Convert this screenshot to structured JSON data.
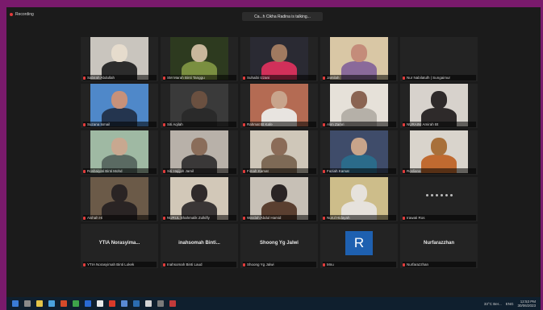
{
  "app": {
    "recording_label": "Recording",
    "talking_indicator": "Ca...h Cikha Radina is talking..."
  },
  "tiles": [
    {
      "name": "Sabirah Abdullah",
      "video": true,
      "bg": "#c9c5be",
      "head": "#e6dccd",
      "body": "#2c2c2c"
    },
    {
      "name": "SM Marah Binti Tanggu",
      "video": true,
      "bg": "#2d3a1f",
      "head": "#c9b79c",
      "body": "#7a8f40"
    },
    {
      "name": "Suhaibi Izzani",
      "video": true,
      "bg": "#2a2a33",
      "head": "#a07a60",
      "body": "#d1305a"
    },
    {
      "name": "Jamilah",
      "video": true,
      "bg": "#d9c7a5",
      "head": "#c48c7a",
      "body": "#8a6a9a"
    },
    {
      "name": "Nur Nabilatulh | Sungaimur",
      "video": false
    },
    {
      "name": "Suzana Ismail",
      "video": true,
      "bg": "#4f88c9",
      "head": "#c6917a",
      "body": "#24354f"
    },
    {
      "name": "Siti Aqilah",
      "video": true,
      "bg": "#3a3a3a",
      "head": "#6a5040",
      "body": "#2a2a2a"
    },
    {
      "name": "Rahmat Bt Kafe",
      "video": true,
      "bg": "#b46b53",
      "head": "#c8a48c",
      "body": "#e8e4e0"
    },
    {
      "name": "Alim Zamri",
      "video": true,
      "bg": "#e6e1d9",
      "head": "#8a6452",
      "body": "#b5b0a8"
    },
    {
      "name": "NURAINI Amirah Bt",
      "video": true,
      "bg": "#d7d2cc",
      "head": "#2e2a2a",
      "body": "#2e2a2a"
    },
    {
      "name": "Rosbaiyati Binti Mohd",
      "video": true,
      "bg": "#9fb9a3",
      "head": "#c8a890",
      "body": "#5a6a62"
    },
    {
      "name": "Siti Hajijah Jamil",
      "video": true,
      "bg": "#b8b1a9",
      "head": "#8a6d5a",
      "body": "#3a3838"
    },
    {
      "name": "Fimah Kamat",
      "video": true,
      "bg": "#cfc7b9",
      "head": "#8b6c58",
      "body": "#7e6a56"
    },
    {
      "name": "Faziah Kamat",
      "video": true,
      "bg": "#3f4c6a",
      "head": "#c8a48a",
      "body": "#2b6b8a"
    },
    {
      "name": "Rosliana",
      "video": true,
      "bg": "#d9d4cc",
      "head": "#a8703a",
      "body": "#c06a30"
    },
    {
      "name": "Aishah Hi",
      "video": true,
      "bg": "#6b5a48",
      "head": "#2a2424",
      "body": "#2a2424"
    },
    {
      "name": "NURUL Shahmalik Zulkifly",
      "video": true,
      "bg": "#d2c8b8",
      "head": "#2f2a2a",
      "body": "#3a3636"
    },
    {
      "name": "Wardah Abdul Hamid",
      "video": true,
      "bg": "#c7c0b6",
      "head": "#2a2424",
      "body": "#5a3f30"
    },
    {
      "name": "Nurul Hidayah",
      "video": true,
      "bg": "#cdbd8a",
      "head": "#e6e2dc",
      "body": "#e6e2dc"
    },
    {
      "name": "Irawati Ros",
      "video": false,
      "dots": true
    },
    {
      "name": "YTIA Norasyimah Binti Lokek",
      "video": false,
      "big": "YTIA Norasyima..."
    },
    {
      "name": "Inahsomah Binti Laud",
      "video": false,
      "big": "inahsomah Binti..."
    },
    {
      "name": "Shoong Yg Jalwi",
      "video": false,
      "big": "Shoong Yg Jalwi"
    },
    {
      "name": "Mnu",
      "video": false,
      "avatar": "R"
    },
    {
      "name": "Nurfarazzhan",
      "video": false,
      "big": "Nurfarazzhan"
    }
  ],
  "taskbar": {
    "icons": [
      "#3a7bd5",
      "#8a8a8a",
      "#e4c448",
      "#4aa3df",
      "#d44a2a",
      "#3ea34a",
      "#2a6ad4",
      "#e8e8e8",
      "#d93a2a",
      "#5a8ad4",
      "#2b6cb0",
      "#d4d4d4",
      "#7a7a7a",
      "#c23a3a"
    ],
    "weather": "33°C Ber...",
    "lang": "ENG",
    "time": "12:53 PM",
    "date": "30/06/2023"
  }
}
